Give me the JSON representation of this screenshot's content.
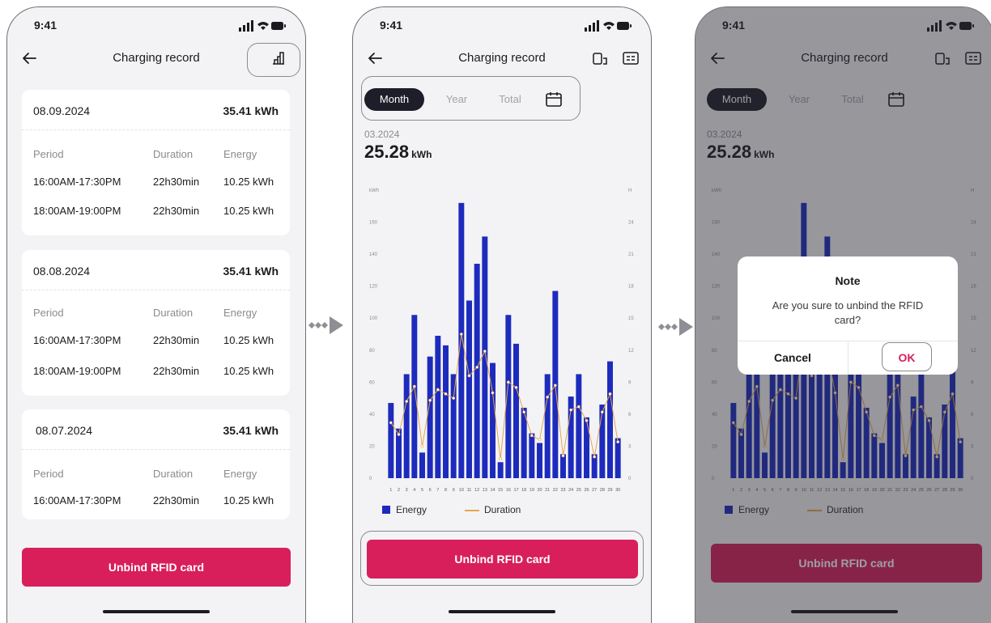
{
  "status": {
    "time": "9:41"
  },
  "screen1": {
    "title": "Charging record",
    "headers": {
      "period": "Period",
      "duration": "Duration",
      "energy": "Energy"
    },
    "records": [
      {
        "date": "08.09.2024",
        "total": "35.41 kWh",
        "rows": [
          {
            "period": "16:00AM-17:30PM",
            "duration": "22h30min",
            "energy": "10.25 kWh"
          },
          {
            "period": "18:00AM-19:00PM",
            "duration": "22h30min",
            "energy": "10.25 kWh"
          }
        ]
      },
      {
        "date": "08.08.2024",
        "total": "35.41 kWh",
        "rows": [
          {
            "period": "16:00AM-17:30PM",
            "duration": "22h30min",
            "energy": "10.25 kWh"
          },
          {
            "period": "18:00AM-19:00PM",
            "duration": "22h30min",
            "energy": "10.25 kWh"
          }
        ]
      },
      {
        "date": "08.07.2024",
        "total": "35.41 kWh",
        "rows": [
          {
            "period": "16:00AM-17:30PM",
            "duration": "22h30min",
            "energy": "10.25 kWh"
          }
        ]
      }
    ],
    "button": "Unbind RFID card"
  },
  "screen2": {
    "title": "Charging record",
    "tabs": [
      "Month",
      "Year",
      "Total"
    ],
    "period": "03.2024",
    "value": "25.28",
    "unit": "kWh",
    "button": "Unbind RFID card"
  },
  "screen3": {
    "title": "Charging record",
    "tabs": [
      "Month",
      "Year",
      "Total"
    ],
    "period": "03.2024",
    "value": "25.28",
    "unit": "kWh",
    "button": "Unbind RFID card",
    "modal": {
      "title": "Note",
      "message": "Are you sure to unbind the RFID card?",
      "cancel": "Cancel",
      "ok": "OK"
    }
  },
  "colors": {
    "accent": "#d81f5b",
    "bar": "#1d2bbd",
    "line": "#e8a64a",
    "tab_active": "#1e1e2a"
  },
  "chart_data": {
    "type": "bar",
    "left_axis_label": "kWh",
    "right_axis_label": "H",
    "left_ticks": [
      0,
      20,
      40,
      60,
      80,
      100,
      120,
      140,
      160
    ],
    "right_ticks": [
      0,
      3,
      6,
      9,
      12,
      15,
      18,
      21,
      24
    ],
    "ylim_left": [
      0,
      180
    ],
    "ylim_right": [
      0,
      27
    ],
    "categories": [
      "1",
      "2",
      "3",
      "4",
      "5",
      "6",
      "7",
      "8",
      "9",
      "10",
      "11",
      "12",
      "13",
      "14",
      "15",
      "16",
      "17",
      "18",
      "19",
      "20",
      "21",
      "22",
      "23",
      "24",
      "25",
      "26",
      "27",
      "28",
      "29",
      "30"
    ],
    "series": [
      {
        "name": "Energy",
        "type": "bar",
        "axis": "left",
        "values": [
          47,
          31,
          65,
          102,
          16,
          76,
          89,
          83,
          65,
          172,
          111,
          134,
          151,
          72,
          10,
          102,
          84,
          44,
          28,
          22,
          65,
          117,
          15,
          51,
          65,
          38,
          15,
          46,
          73,
          25
        ]
      },
      {
        "name": "Duration",
        "type": "line",
        "axis": "right",
        "values": [
          5.2,
          4.1,
          7.2,
          8.6,
          3.0,
          7.3,
          8.3,
          7.9,
          7.5,
          13.5,
          9.6,
          10.4,
          11.9,
          8.0,
          1.8,
          9.0,
          8.5,
          6.2,
          4.0,
          3.6,
          7.6,
          8.7,
          2.1,
          6.4,
          6.7,
          5.4,
          2.0,
          6.2,
          7.9,
          3.4
        ]
      }
    ]
  }
}
